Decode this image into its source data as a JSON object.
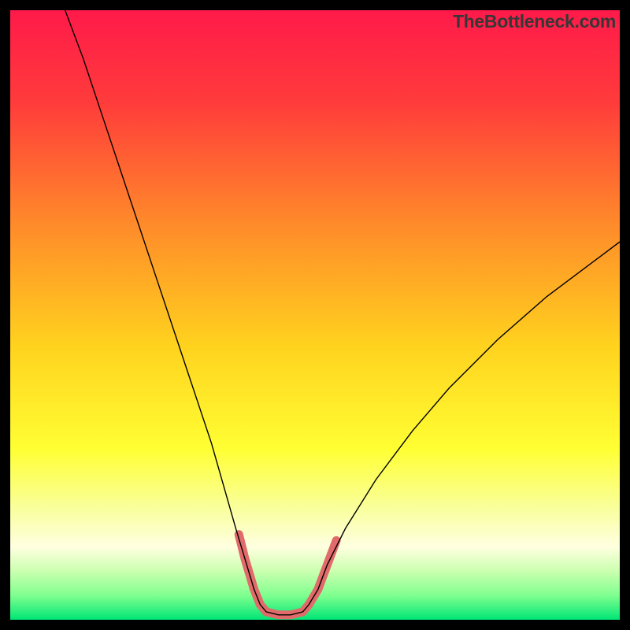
{
  "watermark": "TheBottleneck.com",
  "chart_data": {
    "type": "line",
    "title": "",
    "xlabel": "",
    "ylabel": "",
    "xlim": [
      0,
      100
    ],
    "ylim": [
      0,
      100
    ],
    "background_gradient": {
      "stops": [
        {
          "offset": 0.0,
          "color": "#ff1a4a"
        },
        {
          "offset": 0.15,
          "color": "#ff3b3b"
        },
        {
          "offset": 0.35,
          "color": "#ff8a2a"
        },
        {
          "offset": 0.55,
          "color": "#ffd21e"
        },
        {
          "offset": 0.72,
          "color": "#ffff33"
        },
        {
          "offset": 0.82,
          "color": "#f9ffa0"
        },
        {
          "offset": 0.88,
          "color": "#ffffe0"
        },
        {
          "offset": 0.92,
          "color": "#ccffb0"
        },
        {
          "offset": 0.96,
          "color": "#7fff8f"
        },
        {
          "offset": 1.0,
          "color": "#00e676"
        }
      ]
    },
    "series": [
      {
        "name": "bottleneck-curve",
        "color": "#000000",
        "width": 1.4,
        "points": [
          {
            "x": 9,
            "y": 100
          },
          {
            "x": 12,
            "y": 92
          },
          {
            "x": 15,
            "y": 83
          },
          {
            "x": 18,
            "y": 74
          },
          {
            "x": 21,
            "y": 65
          },
          {
            "x": 24,
            "y": 56
          },
          {
            "x": 27,
            "y": 47
          },
          {
            "x": 30,
            "y": 38
          },
          {
            "x": 33,
            "y": 29
          },
          {
            "x": 35,
            "y": 22
          },
          {
            "x": 37,
            "y": 15
          },
          {
            "x": 38.5,
            "y": 10
          },
          {
            "x": 40,
            "y": 5
          },
          {
            "x": 41,
            "y": 2.5
          },
          {
            "x": 42,
            "y": 1.3
          },
          {
            "x": 44,
            "y": 0.8
          },
          {
            "x": 46,
            "y": 0.8
          },
          {
            "x": 48,
            "y": 1.3
          },
          {
            "x": 49,
            "y": 2.5
          },
          {
            "x": 50.5,
            "y": 5
          },
          {
            "x": 52,
            "y": 9
          },
          {
            "x": 55,
            "y": 15
          },
          {
            "x": 60,
            "y": 23
          },
          {
            "x": 66,
            "y": 31
          },
          {
            "x": 72,
            "y": 38
          },
          {
            "x": 80,
            "y": 46
          },
          {
            "x": 88,
            "y": 53
          },
          {
            "x": 96,
            "y": 59
          },
          {
            "x": 100,
            "y": 62
          }
        ]
      },
      {
        "name": "optimal-range-highlight",
        "color": "#e16a6a",
        "width": 11,
        "linecap": "round",
        "points": [
          {
            "x": 37.5,
            "y": 14
          },
          {
            "x": 38.5,
            "y": 10
          },
          {
            "x": 40,
            "y": 5
          },
          {
            "x": 41,
            "y": 2.5
          },
          {
            "x": 42,
            "y": 1.3
          },
          {
            "x": 44,
            "y": 0.8
          },
          {
            "x": 46,
            "y": 0.8
          },
          {
            "x": 48,
            "y": 1.3
          },
          {
            "x": 49,
            "y": 2.5
          },
          {
            "x": 50.5,
            "y": 5
          },
          {
            "x": 52,
            "y": 9
          },
          {
            "x": 53.5,
            "y": 13
          }
        ]
      }
    ]
  }
}
